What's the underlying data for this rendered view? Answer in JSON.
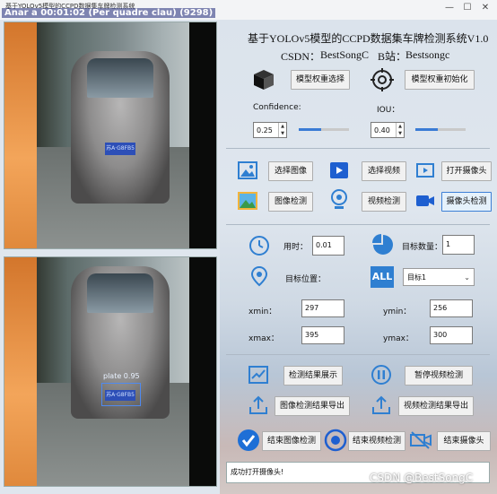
{
  "window": {
    "title": "基于YOLOv5模型的CCPD数据集车牌检测系统",
    "overlay": "Anar a 00:01:02 (Per quadre clau) (9298)",
    "minimize": "—",
    "maximize": "☐",
    "close": "✕"
  },
  "videos": {
    "top_plate": "苏A·G8FB5",
    "bottom_plate": "苏A·G8FB5",
    "detection_label": "plate 0.95"
  },
  "header": {
    "title": "基于YOLOv5模型的CCPD数据集车牌检测系统V1.0",
    "csdn_label": "CSDN：",
    "csdn_value": "BestSongC",
    "bilibili_label": "B站：",
    "bilibili_value": "Bestsongc"
  },
  "weights": {
    "select_button": "模型权重选择",
    "init_button": "模型权重初始化"
  },
  "thresholds": {
    "confidence_label": "Confidence:",
    "confidence_value": "0.25",
    "confidence_level": 0.45,
    "iou_label": "IOU：",
    "iou_value": "0.40",
    "iou_level": 0.45
  },
  "sources": {
    "select_image": "选择图像",
    "select_video": "选择视频",
    "open_camera": "打开摄像头",
    "image_detect": "图像检测",
    "video_detect": "视频检测",
    "camera_detect": "摄像头检测"
  },
  "results": {
    "time_label": "用时：",
    "time_value": "0.01",
    "count_label": "目标数量：",
    "count_value": "1",
    "position_label": "目标位置：",
    "target_select": "目标1",
    "all_icon_text": "ALL",
    "xmin_label": "xmin：",
    "xmin_value": "297",
    "ymin_label": "ymin：",
    "ymin_value": "256",
    "xmax_label": "xmax：",
    "xmax_value": "395",
    "ymax_label": "ymax：",
    "ymax_value": "300"
  },
  "actions": {
    "show_results": "检测结果展示",
    "pause_video": "暂停视频检测",
    "export_image": "图像检测结果导出",
    "export_video": "视频检测结果导出",
    "end_image": "结束图像检测",
    "end_video": "结束视频检测",
    "close_camera": "结束摄像头"
  },
  "status": {
    "message": "成功打开摄像头!"
  },
  "watermark": "CSDN @BestSongC",
  "colors": {
    "accent": "#3a7bd5",
    "icon_blue": "#2f7fd1",
    "plate_blue": "#2d4fb7"
  }
}
